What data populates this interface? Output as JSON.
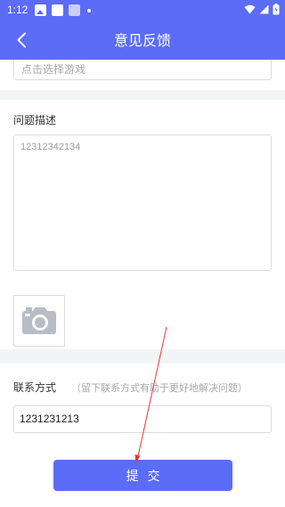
{
  "status_bar": {
    "time": "1:12"
  },
  "header": {
    "title": "意见反馈",
    "back_icon": "chevron-left-icon"
  },
  "game": {
    "placeholder": "点击选择游戏"
  },
  "description": {
    "label": "问题描述",
    "value": "12312342134"
  },
  "photo": {
    "icon": "camera-icon"
  },
  "contact": {
    "label": "联系方式",
    "hint": "（留下联系方式有助于更好地解决问题）",
    "value": "1231231213"
  },
  "submit": {
    "label": "提交"
  },
  "colors": {
    "primary": "#5b6cf6",
    "annotation_arrow": "#e53935"
  }
}
